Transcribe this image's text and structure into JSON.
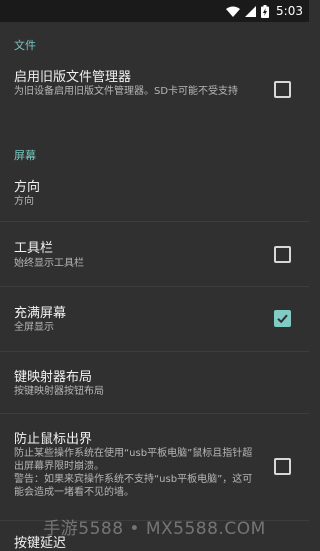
{
  "status_bar": {
    "time": "5:03",
    "icons": [
      "wifi-icon",
      "signal-icon",
      "battery-charging-icon"
    ]
  },
  "sections": {
    "file": {
      "header": "文件"
    },
    "screen": {
      "header": "屏幕"
    }
  },
  "items": {
    "legacy_file_manager": {
      "title": "启用旧版文件管理器",
      "summary": "为旧设备启用旧版文件管理器。SD卡可能不受支持",
      "checked": false
    },
    "orientation": {
      "title": "方向",
      "summary": "方向"
    },
    "toolbar": {
      "title": "工具栏",
      "summary": "始终显示工具栏",
      "checked": false
    },
    "fullscreen": {
      "title": "充满屏幕",
      "summary": "全屏显示",
      "checked": true
    },
    "keymapper_layout": {
      "title": "键映射器布局",
      "summary": "按键映射器按钮布局"
    },
    "prevent_mouse": {
      "title": "防止鼠标出界",
      "summary": "防止某些操作系统在使用“usb平板电脑”鼠标且指针超出屏幕界限时崩溃。\n警告：如果来宾操作系统不支持“usb平板电脑”，这可能会造成一堵看不见的墙。",
      "checked": false
    },
    "key_delay": {
      "title": "按键延迟"
    }
  },
  "watermark": "手游5588 • MX5588.COM",
  "colors": {
    "accent": "#80cbc4",
    "background": "#303030",
    "status_bar": "#1a1a1a"
  }
}
